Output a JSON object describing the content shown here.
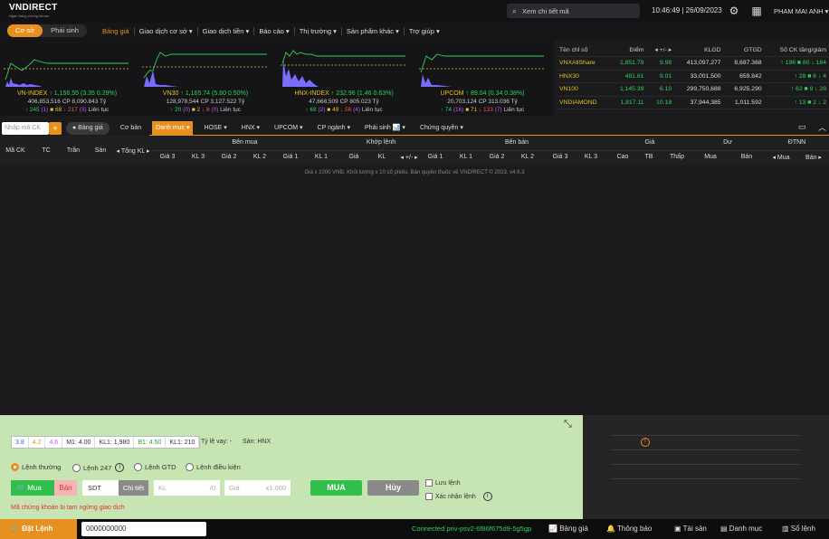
{
  "header": {
    "logo": "VNDIRECT",
    "logo_sub": "Ngân hàng chứng khoán",
    "search_placeholder": "Xem chi tiết mã",
    "clock": "10:46:49 | 26/09/2023",
    "user": "PHAM MAI ANH"
  },
  "nav": {
    "tabs": [
      "Cơ sở",
      "Phái sinh"
    ],
    "menu": [
      "Bảng giá",
      "Giao dịch cơ sở ▾",
      "Giao dịch tiền ▾",
      "Báo cáo ▾",
      "Thị trường ▾",
      "Sản phẩm khác ▾",
      "Trợ giúp ▾"
    ]
  },
  "minis": [
    {
      "name": "VN-INDEX",
      "change": "↑ 1,156.55 (3.35 0.29%)",
      "vol": "406,853,516",
      "cp": "CP 8,090.843 Tỷ",
      "up": "↑ 245",
      "ce": "(1)",
      "ref": "■ 68",
      "down": "↓ 217",
      "ceil_count": "(3)",
      "state": "Liên tục"
    },
    {
      "name": "VN30",
      "change": "↑ 1,165.74 (5.80 0.50%)",
      "vol": "128,978,544",
      "cp": "CP 3,127.522 Tỷ",
      "up": "↑ 20",
      "ce": "(0)",
      "ref": "■ 2",
      "down": "↓ 8",
      "ceil_count": "(0)",
      "state": "Liên tục"
    },
    {
      "name": "HNX-INDEX",
      "change": "↑ 232.96 (1.46 0.63%)",
      "vol": "47,668,509",
      "cp": "CP 805.023 Tỷ",
      "up": "↑ 68",
      "ce": "(2)",
      "ref": "■ 49",
      "down": "↓ 56",
      "ceil_count": "(4)",
      "state": "Liên tục"
    },
    {
      "name": "UPCOM",
      "change": "↑ 89.04 (0.34 0.38%)",
      "vol": "20,703,124",
      "cp": "CP 313.036 Tỷ",
      "up": "↑ 74",
      "ce": "(16)",
      "ref": "■ 71",
      "down": "↓ 133",
      "ceil_count": "(7)",
      "state": "Liên tục"
    }
  ],
  "index_table": {
    "headers": [
      "Tên chỉ số",
      "Điểm",
      "◂ +/- ▸",
      "KLGD",
      "GTGD",
      "Số CK tăng/giảm"
    ],
    "rows": [
      [
        "VNXAllShare",
        "1,851.79",
        "9.98",
        "413,097,277",
        "8,687.368",
        "↑ 196 ■ 80 ↓ 184"
      ],
      [
        "HNX30",
        "481.61",
        "9.01",
        "33,001,500",
        "659.842",
        "↑ 28 ■ 6 ↓ 4"
      ],
      [
        "VN100",
        "1,145.39",
        "6.10",
        "299,750,688",
        "6,925.290",
        "↑ 62 ■ 9 ↓ 28"
      ],
      [
        "VNDIAMOND",
        "1,817.11",
        "10.18",
        "37,944,385",
        "1,011.592",
        "↑ 13 ■ 2 ↓ 2"
      ]
    ]
  },
  "toolbar": {
    "input_placeholder": "Nhập mã CK",
    "board": "Bảng giá",
    "basic": "Cơ bản",
    "items": [
      "Danh mục ▾",
      "HOSE ▾",
      "HNX ▾",
      "UPCOM ▾",
      "CP ngành ▾",
      "Phái sinh 📊 ▾",
      "Chứng quyền ▾"
    ]
  },
  "grid": {
    "left": [
      "Mã CK",
      "TC",
      "Trần",
      "Sàn",
      "◂ Tổng KL ▸"
    ],
    "groups": [
      "Bên mua",
      "Khớp lệnh",
      "Bên bán",
      "Giá",
      "Dư",
      "ĐTNN"
    ],
    "sub": [
      "Giá 3",
      "KL 3",
      "Giá 2",
      "KL 2",
      "Giá 1",
      "KL 1",
      "Giá",
      "KL",
      "◂ +/- ▸",
      "Giá 1",
      "KL 1",
      "Giá 2",
      "KL 2",
      "Giá 3",
      "KL 3",
      "Cao",
      "TB",
      "Thấp",
      "Mua",
      "Bán",
      "◂ Mua",
      "Bán ▸"
    ],
    "footer": "Giá x 1000 VNĐ. Khối lượng x 10 cổ phiếu.",
    "footer2": "Bản quyền thuộc về VNDIRECT © 2023. v4.6.3"
  },
  "order": {
    "quotes": [
      "3.8",
      "4.2",
      "4.6",
      "M1: 4.00",
      "KL1: 1,980",
      "B1: 4.50",
      "KL1: 210"
    ],
    "margin": "Tỷ lệ vay: -",
    "exchange": "Sàn: HNX",
    "types": [
      "Lệnh thường",
      "Lệnh 247",
      "Lệnh GTD",
      "Lệnh điều kiện"
    ],
    "buy": "Mua",
    "sell": "Bán",
    "symbol": "SDT",
    "detail": "Chi tiết",
    "kl_placeholder": "KL",
    "kl_suffix": "/0",
    "price_placeholder": "Giá",
    "price_suffix": "x1,000",
    "submit": "MUA",
    "cancel": "Hủy",
    "save": "Lưu lệnh",
    "confirm": "Xác nhận lệnh",
    "warning": "Mã chứng khoán bị tạm ngừng giao dịch"
  },
  "bottom": {
    "place": "Đặt Lệnh",
    "account": "0000000000",
    "status": "Connected priv-psv2-6f86f675d9-5g5gp",
    "links": [
      "Bảng giá",
      "Thông báo",
      "Tài sản",
      "Danh mục",
      "Sổ lệnh"
    ]
  },
  "colors": {
    "accent": "#e8901e",
    "up": "#2fd158",
    "down": "#ff4f4f",
    "ref": "#e8c11e"
  }
}
